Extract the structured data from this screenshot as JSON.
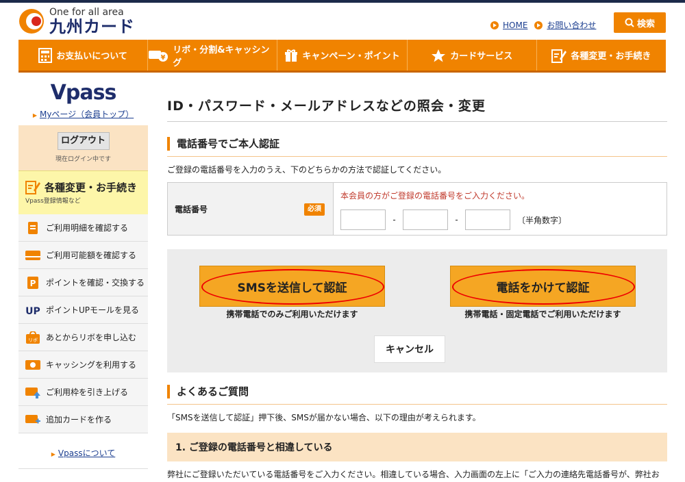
{
  "header": {
    "brand_sub": "One for all area",
    "brand_main": "九州カード",
    "links": [
      "HOME",
      "お問い合わせ"
    ],
    "search_label": "検索"
  },
  "nav": [
    {
      "label": "お支払いについて",
      "icon": "calculator-icon"
    },
    {
      "label": "リボ・分割&キャッシング",
      "icon": "wallet-icon"
    },
    {
      "label": "キャンペーン・ポイント",
      "icon": "gift-icon"
    },
    {
      "label": "カードサービス",
      "icon": "star-icon"
    },
    {
      "label": "各種変更・お手続き",
      "icon": "edit-icon"
    }
  ],
  "sidebar": {
    "logo": "Vpass",
    "mypage": "Myページ（会員トップ）",
    "logout": "ログアウト",
    "logged_in": "現在ログイン中です",
    "proc_title": "各種変更・お手続き",
    "proc_sub": "Vpass登録情報など",
    "items": [
      {
        "label": "ご利用明細を確認する",
        "icon": "statement-icon"
      },
      {
        "label": "ご利用可能額を確認する",
        "icon": "card-icon"
      },
      {
        "label": "ポイントを確認・交換する",
        "icon": "points-icon"
      },
      {
        "label": "ポイントUPモールを見る",
        "icon": "up-icon"
      },
      {
        "label": "あとからリボを申し込む",
        "icon": "revo-icon"
      },
      {
        "label": "キャッシングを利用する",
        "icon": "cashing-icon"
      },
      {
        "label": "ご利用枠を引き上げる",
        "icon": "limit-up-icon"
      },
      {
        "label": "追加カードを作る",
        "icon": "add-card-icon"
      }
    ],
    "about": "Vpassについて"
  },
  "main": {
    "title": "ID・パスワード・メールアドレスなどの照会・変更",
    "section_title": "電話番号でご本人認証",
    "description": "ご登録の電話番号を入力のうえ、下のどちらかの方法で認証してください。",
    "tel_label": "電話番号",
    "required": "必須",
    "tel_note": "本会員の方がご登録の電話番号をご入力ください。",
    "dash": "-",
    "hankaku": "〔半角数字〕",
    "sms_button": "SMSを送信して認証",
    "sms_caption": "携帯電話でのみご利用いただけます",
    "call_button": "電話をかけて認証",
    "call_caption": "携帯電話・固定電話でご利用いただけます",
    "cancel": "キャンセル",
    "faq_title": "よくあるご質問",
    "faq_desc": "「SMSを送信して認証」押下後、SMSが届かない場合、以下の理由が考えられます。",
    "faq_item": "1. ご登録の電話番号と相違している",
    "faq_body": "弊社にご登録いただいている電話番号をご入力ください。相違している場合、入力画面の左上に「ご入力の連絡先電話番号が、弊社お届け内容と一致しません。」と表示されます。"
  },
  "colors": {
    "accent": "#f08300",
    "navy": "#1e2d6b"
  }
}
